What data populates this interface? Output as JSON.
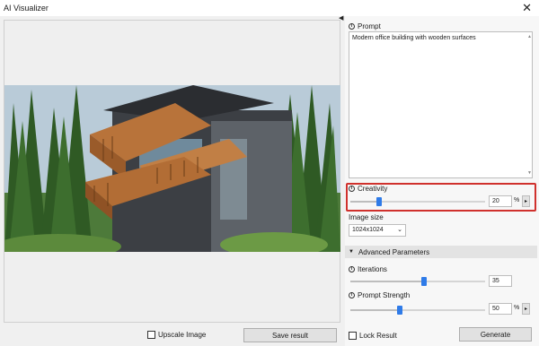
{
  "window": {
    "title": "AI Visualizer",
    "close_glyph": "✕"
  },
  "preview": {
    "image_alt": "Rendered modern office building with wooden surfaces among pine trees"
  },
  "left_footer": {
    "upscale_label": "Upscale Image",
    "save_label": "Save result"
  },
  "prompt": {
    "label": "Prompt",
    "value": "Modern office building with wooden surfaces"
  },
  "creativity": {
    "label": "Creativity",
    "value": "20",
    "unit": "%",
    "level": 0.2
  },
  "image_size": {
    "label": "Image size",
    "selected": "1024x1024"
  },
  "advanced": {
    "label": "Advanced Parameters"
  },
  "iterations": {
    "label": "Iterations",
    "value": "35",
    "level": 0.55
  },
  "prompt_strength": {
    "label": "Prompt Strength",
    "value": "50",
    "unit": "%",
    "level": 0.36
  },
  "right_footer": {
    "lock_label": "Lock Result",
    "generate_label": "Generate"
  },
  "colors": {
    "accent": "#2f7be8",
    "highlight": "#d0312d"
  }
}
